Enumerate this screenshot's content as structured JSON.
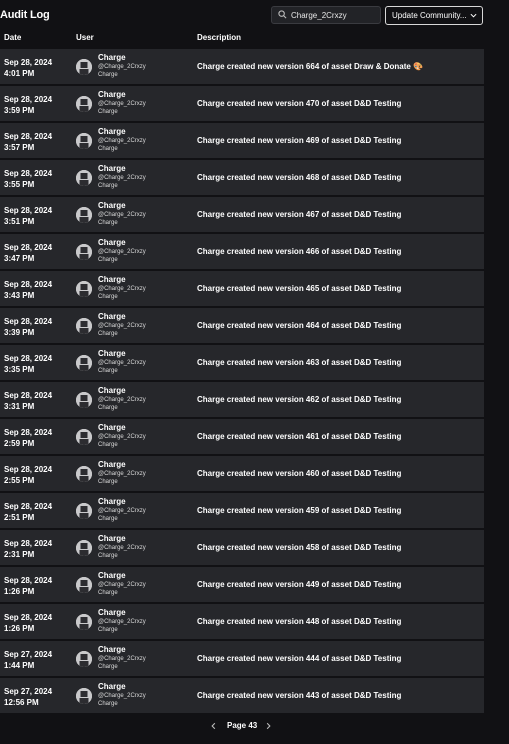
{
  "header": {
    "title": "Audit Log",
    "search_value": "Charge_2Crxzy",
    "dropdown_label": "Update Community..."
  },
  "columns": {
    "date": "Date",
    "user": "User",
    "description": "Description"
  },
  "rows": [
    {
      "date": "Sep 28, 2024",
      "time": "4:01 PM",
      "name": "Charge",
      "handle": "@Charge_2Crxzy",
      "sub": "Charge",
      "desc": "Charge created new version 664 of asset Draw & Donate 🎨"
    },
    {
      "date": "Sep 28, 2024",
      "time": "3:59 PM",
      "name": "Charge",
      "handle": "@Charge_2Crxzy",
      "sub": "Charge",
      "desc": "Charge created new version 470 of asset D&D Testing"
    },
    {
      "date": "Sep 28, 2024",
      "time": "3:57 PM",
      "name": "Charge",
      "handle": "@Charge_2Crxzy",
      "sub": "Charge",
      "desc": "Charge created new version 469 of asset D&D Testing"
    },
    {
      "date": "Sep 28, 2024",
      "time": "3:55 PM",
      "name": "Charge",
      "handle": "@Charge_2Crxzy",
      "sub": "Charge",
      "desc": "Charge created new version 468 of asset D&D Testing"
    },
    {
      "date": "Sep 28, 2024",
      "time": "3:51 PM",
      "name": "Charge",
      "handle": "@Charge_2Crxzy",
      "sub": "Charge",
      "desc": "Charge created new version 467 of asset D&D Testing"
    },
    {
      "date": "Sep 28, 2024",
      "time": "3:47 PM",
      "name": "Charge",
      "handle": "@Charge_2Crxzy",
      "sub": "Charge",
      "desc": "Charge created new version 466 of asset D&D Testing"
    },
    {
      "date": "Sep 28, 2024",
      "time": "3:43 PM",
      "name": "Charge",
      "handle": "@Charge_2Crxzy",
      "sub": "Charge",
      "desc": "Charge created new version 465 of asset D&D Testing"
    },
    {
      "date": "Sep 28, 2024",
      "time": "3:39 PM",
      "name": "Charge",
      "handle": "@Charge_2Crxzy",
      "sub": "Charge",
      "desc": "Charge created new version 464 of asset D&D Testing"
    },
    {
      "date": "Sep 28, 2024",
      "time": "3:35 PM",
      "name": "Charge",
      "handle": "@Charge_2Crxzy",
      "sub": "Charge",
      "desc": "Charge created new version 463 of asset D&D Testing"
    },
    {
      "date": "Sep 28, 2024",
      "time": "3:31 PM",
      "name": "Charge",
      "handle": "@Charge_2Crxzy",
      "sub": "Charge",
      "desc": "Charge created new version 462 of asset D&D Testing"
    },
    {
      "date": "Sep 28, 2024",
      "time": "2:59 PM",
      "name": "Charge",
      "handle": "@Charge_2Crxzy",
      "sub": "Charge",
      "desc": "Charge created new version 461 of asset D&D Testing"
    },
    {
      "date": "Sep 28, 2024",
      "time": "2:55 PM",
      "name": "Charge",
      "handle": "@Charge_2Crxzy",
      "sub": "Charge",
      "desc": "Charge created new version 460 of asset D&D Testing"
    },
    {
      "date": "Sep 28, 2024",
      "time": "2:51 PM",
      "name": "Charge",
      "handle": "@Charge_2Crxzy",
      "sub": "Charge",
      "desc": "Charge created new version 459 of asset D&D Testing"
    },
    {
      "date": "Sep 28, 2024",
      "time": "2:31 PM",
      "name": "Charge",
      "handle": "@Charge_2Crxzy",
      "sub": "Charge",
      "desc": "Charge created new version 458 of asset D&D Testing"
    },
    {
      "date": "Sep 28, 2024",
      "time": "1:26 PM",
      "name": "Charge",
      "handle": "@Charge_2Crxzy",
      "sub": "Charge",
      "desc": "Charge created new version 449 of asset D&D Testing"
    },
    {
      "date": "Sep 28, 2024",
      "time": "1:26 PM",
      "name": "Charge",
      "handle": "@Charge_2Crxzy",
      "sub": "Charge",
      "desc": "Charge created new version 448 of asset D&D Testing"
    },
    {
      "date": "Sep 27, 2024",
      "time": "1:44 PM",
      "name": "Charge",
      "handle": "@Charge_2Crxzy",
      "sub": "Charge",
      "desc": "Charge created new version 444 of asset D&D Testing"
    },
    {
      "date": "Sep 27, 2024",
      "time": "12:56 PM",
      "name": "Charge",
      "handle": "@Charge_2Crxzy",
      "sub": "Charge",
      "desc": "Charge created new version 443 of asset D&D Testing"
    }
  ],
  "pagination": {
    "label": "Page 43"
  },
  "colors": {
    "background": "#111114",
    "row": "#26272b",
    "text": "#ffffff"
  }
}
